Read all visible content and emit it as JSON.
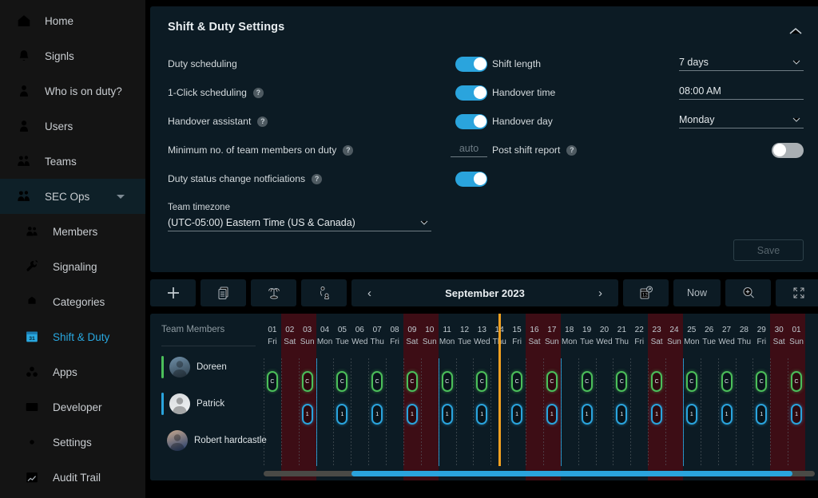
{
  "sidebar": {
    "items": [
      {
        "label": "Home",
        "icon": "home-icon",
        "type": "top"
      },
      {
        "label": "Signls",
        "icon": "bell-icon",
        "type": "top"
      },
      {
        "label": "Who is on duty?",
        "icon": "user-duty-icon",
        "type": "top"
      },
      {
        "label": "Users",
        "icon": "user-icon",
        "type": "top"
      },
      {
        "label": "Teams",
        "icon": "teams-icon",
        "type": "top"
      },
      {
        "label": "SEC Ops",
        "icon": "teams-icon",
        "type": "team",
        "expanded": true
      },
      {
        "label": "Members",
        "icon": "members-icon",
        "type": "sub"
      },
      {
        "label": "Signaling",
        "icon": "signaling-icon",
        "type": "sub"
      },
      {
        "label": "Categories",
        "icon": "categories-icon",
        "type": "sub"
      },
      {
        "label": "Shift & Duty",
        "icon": "calendar-31-icon",
        "type": "sub",
        "active": true
      },
      {
        "label": "Apps",
        "icon": "apps-icon",
        "type": "sub"
      },
      {
        "label": "Developer",
        "icon": "code-icon",
        "type": "sub"
      },
      {
        "label": "Settings",
        "icon": "gear-icon",
        "type": "sub"
      },
      {
        "label": "Audit Trail",
        "icon": "audit-icon",
        "type": "sub"
      }
    ],
    "active_accent": "#29a8e0"
  },
  "settings": {
    "title": "Shift & Duty Settings",
    "collapse_icon": "chevron-up-icon",
    "left": [
      {
        "label": "Duty scheduling",
        "help": false,
        "control": "toggle",
        "value": "on"
      },
      {
        "label": "1-Click scheduling",
        "help": true,
        "control": "toggle",
        "value": "on"
      },
      {
        "label": "Handover assistant",
        "help": true,
        "control": "toggle",
        "value": "on"
      },
      {
        "label": "Minimum no. of team members on duty",
        "help": true,
        "control": "input",
        "value": "",
        "placeholder": "auto"
      },
      {
        "label": "Duty status change notficiations",
        "help": true,
        "control": "toggle",
        "value": "on"
      }
    ],
    "right": [
      {
        "label": "Shift length",
        "help": false,
        "control": "select",
        "value": "7 days"
      },
      {
        "label": "Handover time",
        "help": false,
        "control": "input",
        "value": "08:00 AM"
      },
      {
        "label": "Handover day",
        "help": false,
        "control": "select",
        "value": "Monday"
      },
      {
        "label": "Post shift report",
        "help": true,
        "control": "toggle",
        "value": "off"
      }
    ],
    "timezone": {
      "label": "Team timezone",
      "value": "(UTC-05:00) Eastern Time (US & Canada)"
    },
    "save_label": "Save"
  },
  "toolbar": {
    "buttons": [
      {
        "name": "add-shift-button",
        "icon": "plus-icon",
        "label": ""
      },
      {
        "name": "duplicate-button",
        "icon": "copy-icon",
        "label": ""
      },
      {
        "name": "vacation-button",
        "icon": "palm-tree-icon",
        "label": ""
      },
      {
        "name": "on-call-button",
        "icon": "person-phone-icon",
        "label": ""
      }
    ],
    "prev_label": "‹",
    "next_label": "›",
    "period_label": "September 2023",
    "right_buttons": [
      {
        "name": "publish-calendar-button",
        "icon": "calendar-send-icon",
        "label": ""
      },
      {
        "name": "now-button",
        "icon": "",
        "label": "Now"
      },
      {
        "name": "zoom-in-button",
        "icon": "magnifier-plus-icon",
        "label": ""
      },
      {
        "name": "fullscreen-button",
        "icon": "expand-icon",
        "label": ""
      }
    ]
  },
  "schedule": {
    "members_header": "Team Members",
    "members": [
      {
        "name": "Doreen",
        "accent": "#4bbf5a",
        "avatar_top": "#6f8fa8",
        "avatar_bottom": "#2e3f4c"
      },
      {
        "name": "Patrick",
        "accent": "#2aa4dd",
        "avatar_top": "#d7dadd",
        "avatar_bottom": "#f1f3f4"
      },
      {
        "name": "Robert hardcastle",
        "accent": "#8b7bd8",
        "avatar_top": "#c8a98e",
        "avatar_bottom": "#1e3a6b"
      }
    ],
    "days": [
      {
        "num": "01",
        "dow": "Fri",
        "weekend": false
      },
      {
        "num": "02",
        "dow": "Sat",
        "weekend": true
      },
      {
        "num": "03",
        "dow": "Sun",
        "weekend": true
      },
      {
        "num": "04",
        "dow": "Mon",
        "weekend": false
      },
      {
        "num": "05",
        "dow": "Tue",
        "weekend": false
      },
      {
        "num": "06",
        "dow": "Wed",
        "weekend": false
      },
      {
        "num": "07",
        "dow": "Thu",
        "weekend": false
      },
      {
        "num": "08",
        "dow": "Fri",
        "weekend": false
      },
      {
        "num": "09",
        "dow": "Sat",
        "weekend": true
      },
      {
        "num": "10",
        "dow": "Sun",
        "weekend": true
      },
      {
        "num": "11",
        "dow": "Mon",
        "weekend": false
      },
      {
        "num": "12",
        "dow": "Tue",
        "weekend": false
      },
      {
        "num": "13",
        "dow": "Wed",
        "weekend": false
      },
      {
        "num": "14",
        "dow": "Thu",
        "weekend": false
      },
      {
        "num": "15",
        "dow": "Fri",
        "weekend": false
      },
      {
        "num": "16",
        "dow": "Sat",
        "weekend": true
      },
      {
        "num": "17",
        "dow": "Sun",
        "weekend": true
      },
      {
        "num": "18",
        "dow": "Mon",
        "weekend": false
      },
      {
        "num": "19",
        "dow": "Tue",
        "weekend": false
      },
      {
        "num": "20",
        "dow": "Wed",
        "weekend": false
      },
      {
        "num": "21",
        "dow": "Thu",
        "weekend": false
      },
      {
        "num": "22",
        "dow": "Fri",
        "weekend": false
      },
      {
        "num": "23",
        "dow": "Sat",
        "weekend": true
      },
      {
        "num": "24",
        "dow": "Sun",
        "weekend": true
      },
      {
        "num": "25",
        "dow": "Mon",
        "weekend": false
      },
      {
        "num": "26",
        "dow": "Tue",
        "weekend": false
      },
      {
        "num": "27",
        "dow": "Wed",
        "weekend": false
      },
      {
        "num": "28",
        "dow": "Thu",
        "weekend": false
      },
      {
        "num": "29",
        "dow": "Fri",
        "weekend": false
      },
      {
        "num": "30",
        "dow": "Sat",
        "weekend": true
      },
      {
        "num": "01",
        "dow": "Sun",
        "weekend": true
      }
    ],
    "week_boundaries": [
      3,
      10,
      17,
      24
    ],
    "now_marker_day_index": 13,
    "shifts": [
      {
        "row": 0,
        "color": "green",
        "day_indices": [
          0,
          2,
          4,
          6,
          8,
          10,
          12,
          14,
          16,
          18,
          20,
          22,
          24,
          26,
          28,
          30
        ],
        "badge": "C"
      },
      {
        "row": 1,
        "color": "blue",
        "day_indices": [
          2,
          4,
          6,
          8,
          10,
          12,
          14,
          16,
          18,
          20,
          22,
          24,
          26,
          28,
          30
        ],
        "badge": "1"
      }
    ],
    "scrollbar": {
      "thumb_start_pct": 16,
      "thumb_width_pct": 80
    }
  }
}
